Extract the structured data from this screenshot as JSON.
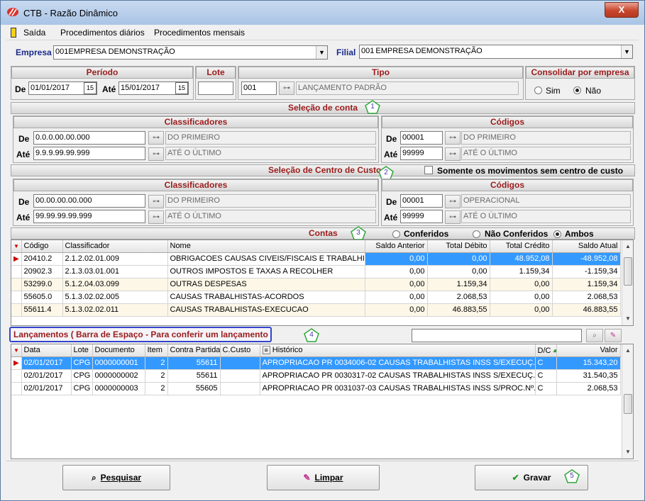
{
  "window": {
    "title": "CTB - Razão Dinâmico",
    "close": "X"
  },
  "menu": {
    "items": [
      "Saída",
      "Procedimentos diários",
      "Procedimentos mensais"
    ]
  },
  "empresa": {
    "label": "Empresa",
    "value": "001EMPRESA DEMONSTRAÇÃO"
  },
  "filial": {
    "label": "Filial",
    "code": "001",
    "value": "EMPRESA DEMONSTRAÇÃO"
  },
  "periodo": {
    "title": "Período",
    "de_label": "De",
    "de": "01/01/2017",
    "ate_label": "Até",
    "ate": "15/01/2017"
  },
  "lote": {
    "title": "Lote",
    "value": ""
  },
  "tipo": {
    "title": "Tipo",
    "code": "001",
    "desc": "LANÇAMENTO PADRÃO"
  },
  "consolidar": {
    "title": "Consolidar por empresa",
    "sim": "Sim",
    "nao": "Não",
    "selected": "Não"
  },
  "selecao_conta": {
    "title": "Seleção de conta",
    "badge": "1",
    "classificadores": {
      "title": "Classificadores",
      "de_label": "De",
      "de": "0.0.0.00.00.000",
      "de_desc": "DO PRIMEIRO",
      "ate_label": "Até",
      "ate": "9.9.9.99.99.999",
      "ate_desc": "ATÉ O ÚLTIMO"
    },
    "codigos": {
      "title": "Códigos",
      "de_label": "De",
      "de": "00001",
      "de_desc": "DO PRIMEIRO",
      "ate_label": "Até",
      "ate": "99999",
      "ate_desc": "ATÉ O ÚLTIMO"
    }
  },
  "selecao_cc": {
    "title": "Seleção de Centro de Custo",
    "badge": "2",
    "somente": "Somente os movimentos sem centro de custo",
    "classificadores": {
      "title": "Classificadores",
      "de_label": "De",
      "de": "00.00.00.00.000",
      "de_desc": "DO PRIMEIRO",
      "ate_label": "Até",
      "ate": "99.99.99.99.999",
      "ate_desc": "ATÉ O ÚLTIMO"
    },
    "codigos": {
      "title": "Códigos",
      "de_label": "De",
      "de": "00001",
      "de_desc": "OPERACIONAL",
      "ate_label": "Até",
      "ate": "99999",
      "ate_desc": "ATÉ O ÚLTIMO"
    }
  },
  "contas": {
    "title": "Contas",
    "badge": "3",
    "filters": [
      "Conferidos",
      "Não Conferidos",
      "Ambos"
    ],
    "selected_filter": "Ambos",
    "columns": [
      "Código",
      "Classificador",
      "Nome",
      "Saldo Anterior",
      "Total Débito",
      "Total Crédito",
      "Saldo Atual"
    ],
    "rows": [
      [
        "20410.2",
        "2.1.2.02.01.009",
        "OBRIGACOES CAUSAS CIVEIS/FISCAIS E TRABALHI...",
        "0,00",
        "0,00",
        "48.952,08",
        "-48.952,08"
      ],
      [
        "20902.3",
        "2.1.3.03.01.001",
        "OUTROS IMPOSTOS E TAXAS A RECOLHER",
        "0,00",
        "0,00",
        "1.159,34",
        "-1.159,34"
      ],
      [
        "53299.0",
        "5.1.2.04.03.099",
        "OUTRAS DESPESAS",
        "0,00",
        "1.159,34",
        "0,00",
        "1.159,34"
      ],
      [
        "55605.0",
        "5.1.3.02.02.005",
        "CAUSAS TRABALHISTAS-ACORDOS",
        "0,00",
        "2.068,53",
        "0,00",
        "2.068,53"
      ],
      [
        "55611.4",
        "5.1.3.02.02.011",
        "CAUSAS TRABALHISTAS-EXECUCAO",
        "0,00",
        "46.883,55",
        "0,00",
        "46.883,55"
      ]
    ]
  },
  "lancamentos": {
    "title": "Lançamentos ( Barra de Espaço - Para conferir um lançamento",
    "badge": "4",
    "search": "",
    "columns": [
      "Data",
      "Lote",
      "Documento",
      "Item",
      "Contra Partida",
      "C.Custo",
      "Histórico",
      "D/C",
      "Valor"
    ],
    "rows": [
      [
        "02/01/2017",
        "CPG",
        "0000000001",
        "2",
        "55611",
        "",
        "APROPRIACAO PR 0034006-02 CAUSAS TRABALHISTAS INSS S/EXECUÇ...",
        "C",
        "15.343,20"
      ],
      [
        "02/01/2017",
        "CPG",
        "0000000002",
        "2",
        "55611",
        "",
        "APROPRIACAO PR 0030317-02 CAUSAS TRABALHISTAS INSS S/EXECUÇ...",
        "C",
        "31.540,35"
      ],
      [
        "02/01/2017",
        "CPG",
        "0000000003",
        "2",
        "55605",
        "",
        "APROPRIACAO PR 0031037-03 CAUSAS TRABALHISTAS INSS S/PROC.Nº...",
        "C",
        "2.068,53"
      ]
    ]
  },
  "buttons": {
    "pesquisar": "Pesquisar",
    "limpar": "Limpar",
    "gravar": "Gravar",
    "badge": "5"
  },
  "icons": {
    "app": "red-logo-icon",
    "exit": "door-icon",
    "binoculars": "binoculars-icon",
    "calendar": "calendar-icon",
    "search": "magnifier-icon",
    "eraser": "eraser-icon",
    "check": "checkmark-icon"
  },
  "colors": {
    "group_title": "#9b1b1b",
    "selection": "#3399ff",
    "highlight_box": "#3344cc",
    "badge": "#1d6a1d"
  }
}
